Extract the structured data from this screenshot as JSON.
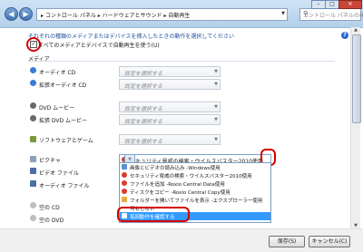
{
  "breadcrumb": {
    "text": "▸ コントロール パネル ▸ ハードウェアとサウンド ▸ 自動再生"
  },
  "search": {
    "placeholder": "コントロール パネルの検..."
  },
  "intro": {
    "text": "それぞれの種類のメディアまたはデバイスを挿入したときの動作を選択してください"
  },
  "master_checkbox": {
    "label": "すべてのメディアとデバイスで自動再生を使う(U)",
    "checked": true
  },
  "section": {
    "title": "メディア"
  },
  "default_combo_text": "既定を選択する",
  "rows": [
    {
      "label": "オーディオ CD",
      "value": "既定を選択する",
      "icon_color": "#3a7bd5"
    },
    {
      "label": "拡張オーディオ CD",
      "value": "既定を選択する",
      "icon_color": "#3a7bd5"
    },
    {
      "label": "DVD ムービー",
      "value": "既定を選択する",
      "icon_color": "#6b6b6b"
    },
    {
      "label": "拡張 DVD ムービー",
      "value": "既定を選択する",
      "icon_color": "#6b6b6b"
    },
    {
      "label": "ソフトウェアとゲーム",
      "value": "既定を選択する",
      "icon_color": "#7a9a3a"
    },
    {
      "label": "ピクチャ",
      "value": "セキュリティ脅威の検索・ウイルスバスター2010使用",
      "icon_color": "#8ca0b8"
    },
    {
      "label": "ビデオ ファイル",
      "value": "",
      "icon_color": "#4b6fa5"
    },
    {
      "label": "オーディオ ファイル",
      "value": "",
      "icon_color": "#4b6fa5"
    },
    {
      "label": "空の CD",
      "value": "",
      "icon_color": "#bdbdbd"
    },
    {
      "label": "空の DVD",
      "value": "",
      "icon_color": "#bdbdbd"
    }
  ],
  "dropdown_options": [
    {
      "label": "画像とビデオの読み込み -Windows使用",
      "icon_color": "#5b8fd6",
      "selected": false
    },
    {
      "label": "セキュリティ脅威の検索・ウイルスバスター2010使用",
      "icon_color": "#d93b2b",
      "selected": false
    },
    {
      "label": "ファイルを追加 -Roxio Central Data使用",
      "icon_color": "#d93b2b",
      "selected": false
    },
    {
      "label": "ディスクをコピー -Roxio Central Copy使用",
      "icon_color": "#d93b2b",
      "selected": false
    },
    {
      "label": "フォルダーを開いてファイルを表示 -エクスプローラー使用",
      "icon_color": "#e0b040",
      "selected": false
    },
    {
      "label": "何もしない",
      "icon_color": "#bbbbbb",
      "selected": false
    },
    {
      "label": "毎回動作を確認する",
      "icon_color": "#5b8fd6",
      "selected": true
    }
  ],
  "buttons": {
    "save": "保存(S)",
    "cancel": "キャンセル(C)"
  }
}
